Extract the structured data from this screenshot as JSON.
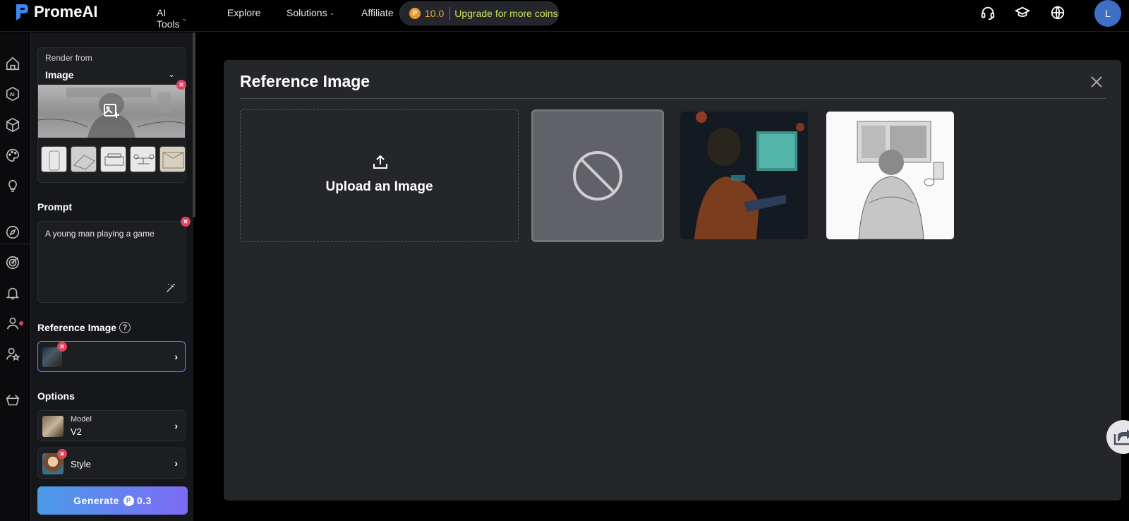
{
  "app": {
    "brand": "PromeAI"
  },
  "nav": {
    "items": [
      {
        "label": "AI Tools",
        "has_dropdown": true
      },
      {
        "label": "Explore",
        "has_dropdown": false
      },
      {
        "label": "Solutions",
        "has_dropdown": true
      },
      {
        "label": "Affiliate",
        "has_dropdown": false
      }
    ]
  },
  "coins": {
    "amount": "10.0",
    "upgrade_label": "Upgrade for more coins"
  },
  "header_icons": [
    "headset-icon",
    "graduation-cap-icon",
    "globe-icon"
  ],
  "user": {
    "avatar_initial": "L"
  },
  "rail": {
    "icons": [
      "home-icon",
      "ai-icon",
      "cube-icon",
      "palette-icon",
      "lightbulb-icon",
      "compass-icon",
      "target-icon",
      "bell-icon",
      "user-icon",
      "user-star-icon",
      "basket-icon"
    ]
  },
  "panel": {
    "render_from": {
      "label": "Render from",
      "value": "Image"
    },
    "prompt": {
      "title": "Prompt",
      "value": "A young man playing a game"
    },
    "reference": {
      "title": "Reference Image"
    },
    "options": {
      "title": "Options",
      "model": {
        "label": "Model",
        "value": "V2"
      },
      "style": {
        "label": "Style"
      }
    },
    "generate": {
      "label": "Generate",
      "cost": "0.3"
    }
  },
  "modal": {
    "title": "Reference Image",
    "upload_label": "Upload an Image"
  },
  "colors": {
    "accent": "#6b82ff",
    "coin_gold": "#f0a23a",
    "upgrade_green": "#c9e35b",
    "danger": "#e0425e",
    "modal_bg": "#25262a"
  }
}
